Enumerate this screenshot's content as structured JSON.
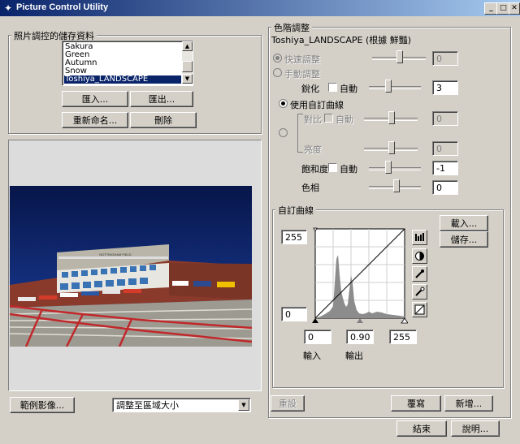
{
  "window": {
    "title": "Picture Control Utility",
    "controls": {
      "minimize": "_",
      "maximize": "□",
      "close": "✕"
    }
  },
  "storage": {
    "group_label": "照片調控的儲存資料",
    "items": [
      {
        "label": "Sakura",
        "selected": false
      },
      {
        "label": "Green",
        "selected": false
      },
      {
        "label": "Autumn",
        "selected": false
      },
      {
        "label": "Snow",
        "selected": false
      },
      {
        "label": "Toshiya_LANDSCAPE",
        "selected": true
      }
    ],
    "import_label": "匯入...",
    "export_label": "匯出...",
    "rename_label": "重新命名...",
    "delete_label": "刪除"
  },
  "preview": {
    "sign_text": "NOTTINGHAM FIELD",
    "sample_image_label": "範例影像...",
    "fit_option": "調整至區域大小"
  },
  "tone": {
    "group_label": "色階調整",
    "picture_control_name": "Toshiya_LANDSCAPE (根據 鮮豔)",
    "quick_adjust": {
      "label": "快速調整",
      "value": "0",
      "enabled": false
    },
    "manual_adjust": {
      "label": "手動調整",
      "enabled": false
    },
    "sharpness": {
      "label": "銳化",
      "auto_label": "自動",
      "value": "3",
      "slider": 0.45
    },
    "use_custom_curve_label": "使用自訂曲線",
    "contrast": {
      "label": "對比",
      "auto_label": "自動",
      "value": "0",
      "enabled": false,
      "slider": 0.5
    },
    "brightness": {
      "label": "亮度",
      "value": "0",
      "enabled": false,
      "slider": 0.5
    },
    "saturation": {
      "label": "飽和度",
      "auto_label": "自動",
      "value": "-1",
      "slider": 0.4
    },
    "hue": {
      "label": "色相",
      "value": "0",
      "slider": 0.5
    }
  },
  "curve": {
    "group_label": "自訂曲線",
    "load_label": "載入...",
    "save_label": "儲存...",
    "output_max": "255",
    "output_min": "0",
    "input_black": "0",
    "gamma": "0.90",
    "input_white": "255",
    "input_label": "輸入",
    "output_label": "輸出"
  },
  "footer": {
    "reset_label": "重設",
    "overwrite_label": "覆寫",
    "new_label": "新增...",
    "close_label": "結束",
    "help_label": "說明..."
  }
}
